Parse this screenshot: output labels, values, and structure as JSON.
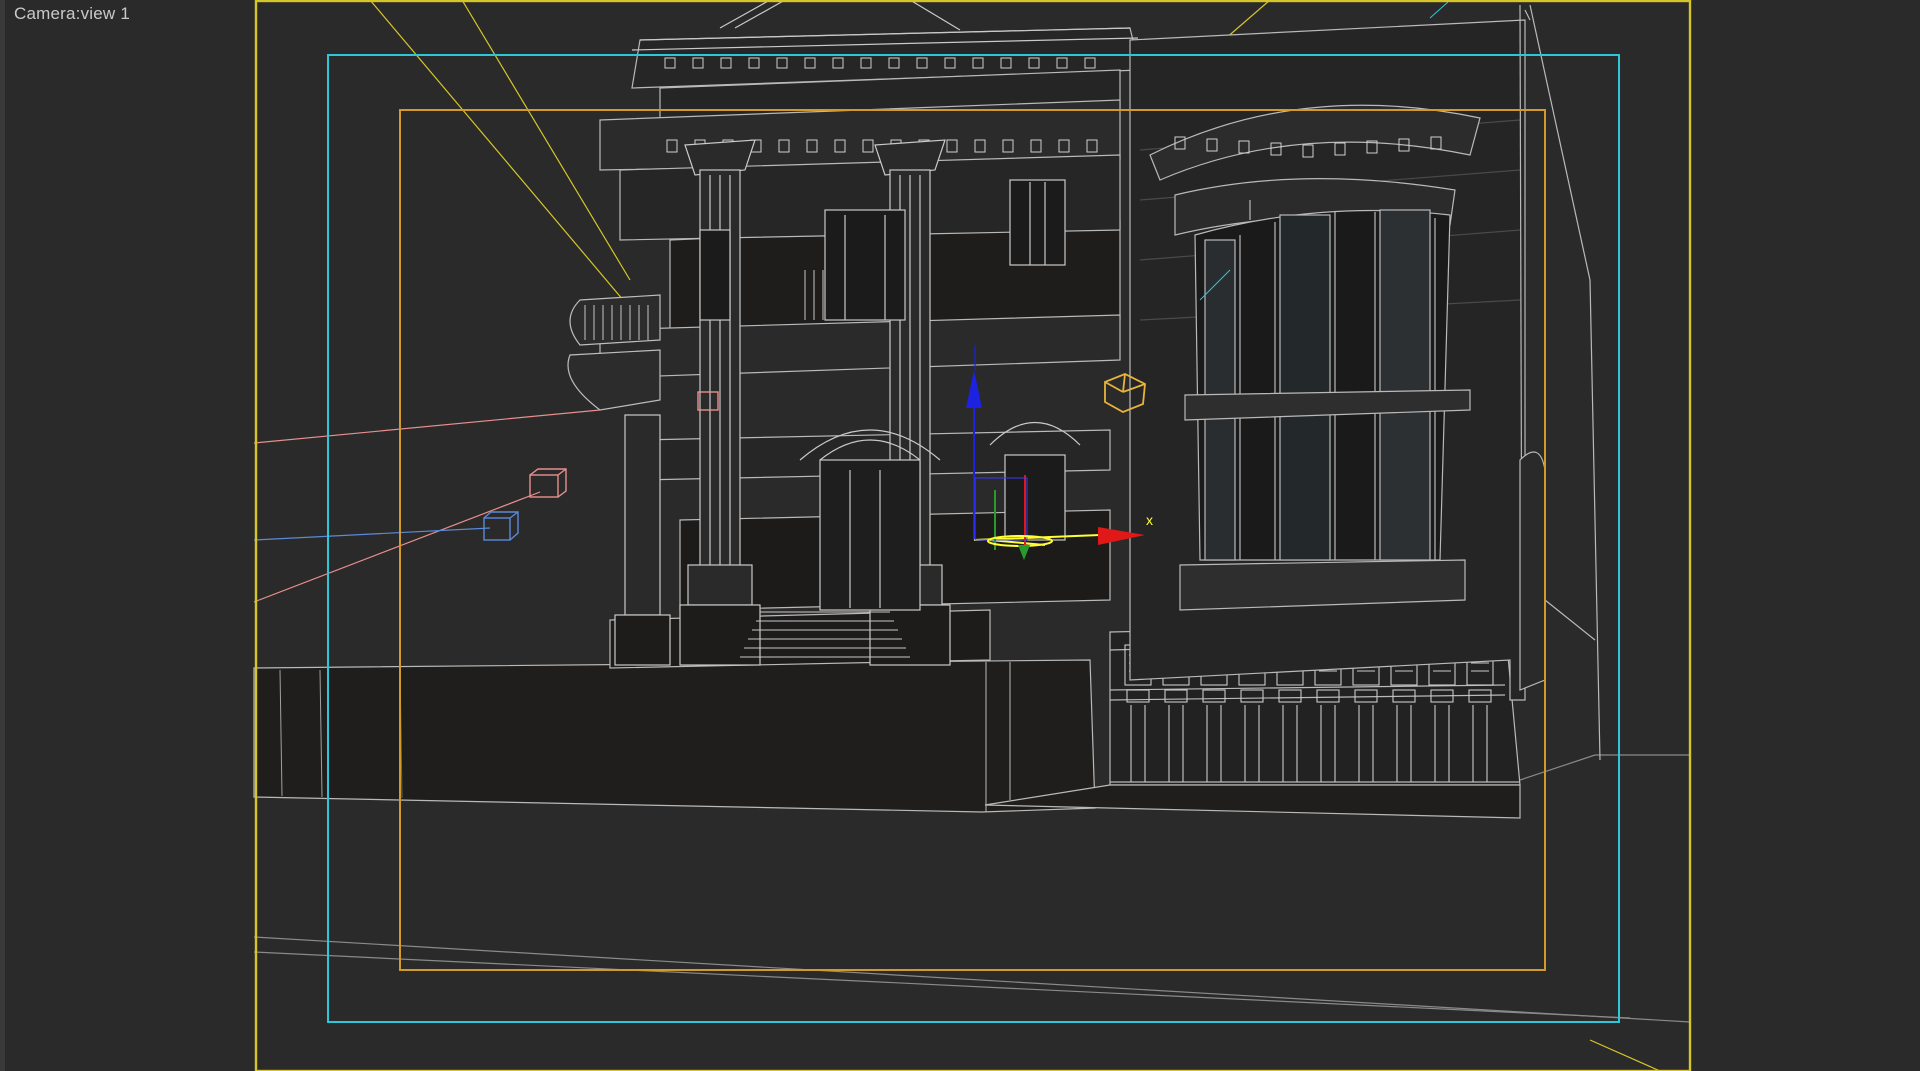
{
  "viewport": {
    "label": "Camera:view 1",
    "background": "#2a2a2a"
  },
  "frames": {
    "render_frame_color": "#d6c52a",
    "action_safe_color": "#2ec7d8",
    "title_safe_color": "#d19a2a"
  },
  "gizmo": {
    "axis_x_label": "x",
    "x_color": "#e01818",
    "y_color": "#2a9a2a",
    "z_color": "#1c22e0",
    "selected_color": "#ffff33"
  },
  "scene": {
    "wire_color": "#b9b9b9",
    "wall_fill": "#1d1c1b",
    "light_target_color": "#e8b33a",
    "light_color_red": "#e88f8f",
    "light_color_blue": "#5a8ad8"
  }
}
